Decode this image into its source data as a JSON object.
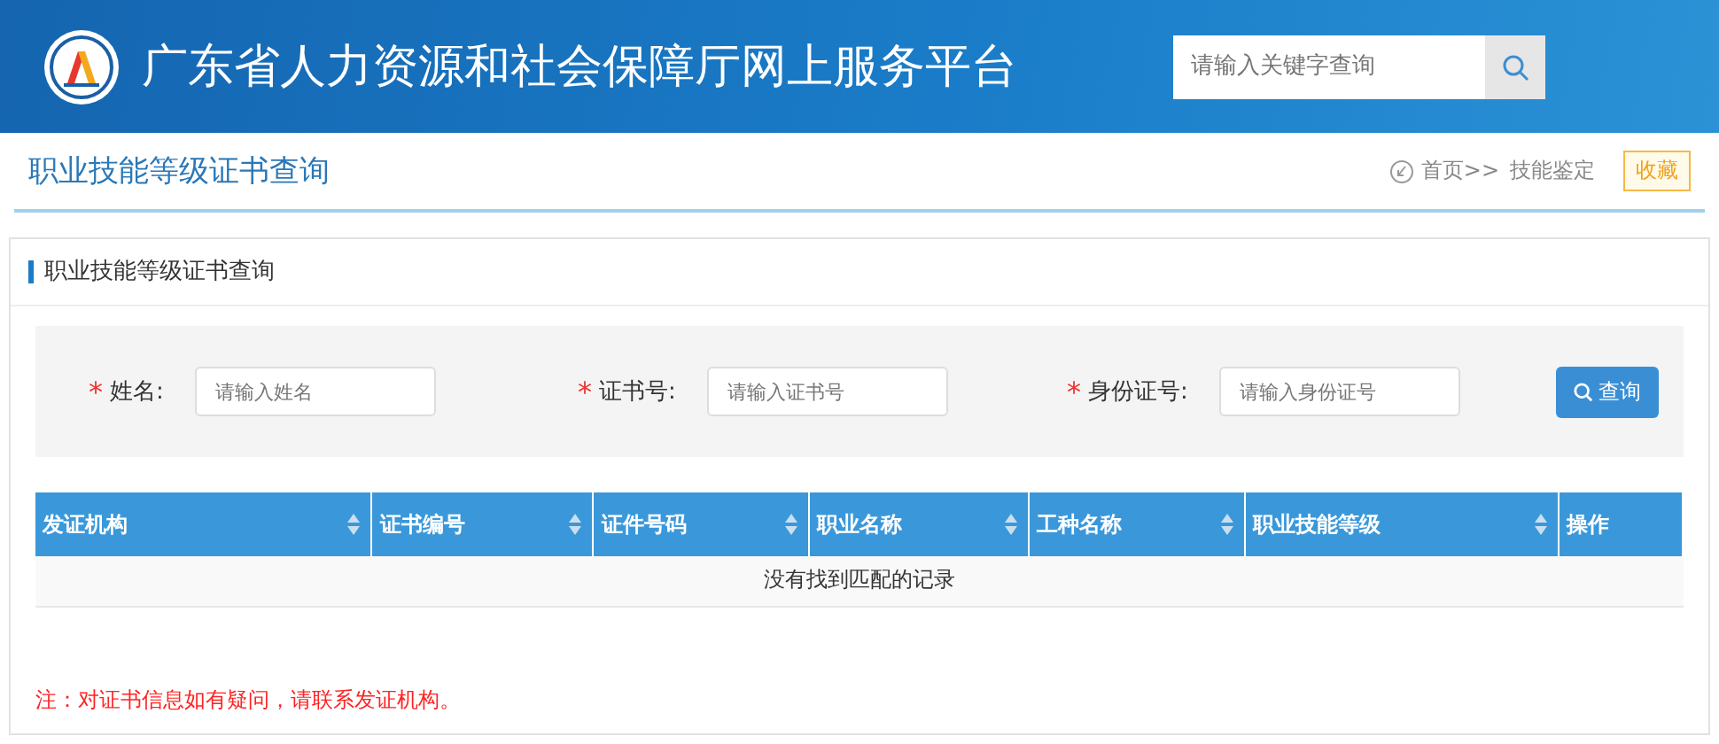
{
  "header": {
    "site_title": "广东省人力资源和社会保障厅网上服务平台",
    "search": {
      "placeholder": "请输入关键字查询"
    }
  },
  "page": {
    "title": "职业技能等级证书查询",
    "breadcrumb": {
      "home": "首页>>",
      "current": "技能鉴定"
    },
    "favorite": "收藏"
  },
  "panel": {
    "title": "职业技能等级证书查询",
    "fields": [
      {
        "required_mark": "*",
        "label": "姓名:",
        "placeholder": "请输入姓名"
      },
      {
        "required_mark": "*",
        "label": "证书号:",
        "placeholder": "请输入证书号"
      },
      {
        "required_mark": "*",
        "label": "身份证号:",
        "placeholder": "请输入身份证号"
      }
    ],
    "search_button": "查询",
    "table": {
      "columns": [
        {
          "label": "发证机构",
          "sortable": true
        },
        {
          "label": "证书编号",
          "sortable": true
        },
        {
          "label": "证件号码",
          "sortable": true
        },
        {
          "label": "职业名称",
          "sortable": true
        },
        {
          "label": "工种名称",
          "sortable": true
        },
        {
          "label": "职业技能等级",
          "sortable": true
        },
        {
          "label": "操作",
          "sortable": false
        }
      ],
      "empty_message": "没有找到匹配的记录"
    },
    "note": "注：对证书信息如有疑问，请联系发证机构。"
  }
}
